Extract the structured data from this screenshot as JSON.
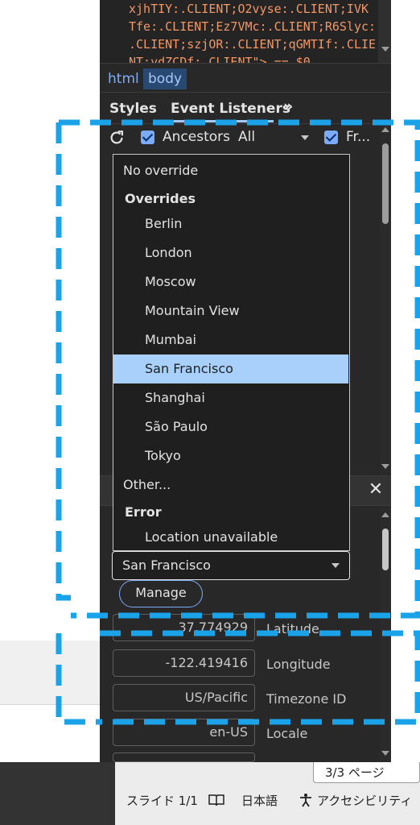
{
  "code_lines": [
    "xjhTIY:.CLIENT;O2vyse:.CLIENT;IVK",
    "Tfe:.CLIENT;Ez7VMc:.CLIENT;R6Slyc:",
    ".CLIENT;szjOR:.CLIENT;qGMTIf:.CLIE",
    "NT;ydZCDf:.CLIENT\"> == $0"
  ],
  "breadcrumbs": [
    "html",
    "body"
  ],
  "tabs": {
    "styles": "Styles",
    "event_listeners": "Event Listeners",
    "more": "»"
  },
  "toolbar": {
    "ancestors": "Ancestors",
    "filter": "All",
    "framework": "Fr..."
  },
  "dropdown": {
    "items": [
      {
        "label": "No override",
        "kind": "option"
      },
      {
        "label": "Overrides",
        "kind": "group"
      },
      {
        "label": "Berlin",
        "kind": "option"
      },
      {
        "label": "London",
        "kind": "option"
      },
      {
        "label": "Moscow",
        "kind": "option"
      },
      {
        "label": "Mountain View",
        "kind": "option"
      },
      {
        "label": "Mumbai",
        "kind": "option"
      },
      {
        "label": "San Francisco",
        "kind": "option",
        "selected": true
      },
      {
        "label": "Shanghai",
        "kind": "option"
      },
      {
        "label": "São Paulo",
        "kind": "option"
      },
      {
        "label": "Tokyo",
        "kind": "option"
      },
      {
        "label": "Other...",
        "kind": "option"
      },
      {
        "label": "Error",
        "kind": "group"
      },
      {
        "label": "Location unavailable",
        "kind": "option"
      }
    ]
  },
  "location_select": {
    "value": "San Francisco"
  },
  "manage_label": "Manage",
  "fields": [
    {
      "value": "37.774929",
      "label": "Latitude"
    },
    {
      "value": "-122.419416",
      "label": "Longitude"
    },
    {
      "value": "US/Pacific",
      "label": "Timezone ID"
    },
    {
      "value": "en-US",
      "label": "Locale"
    }
  ],
  "status_bar": {
    "page_count": "3/3 ページ",
    "slide": "スライド 1/1",
    "language": "日本語",
    "accessibility": "アクセシビリティ"
  },
  "colors": {
    "highlight_dash": "#1aa3e8",
    "selected_item": "#a8d0fb",
    "accent": "#7cacf8"
  }
}
